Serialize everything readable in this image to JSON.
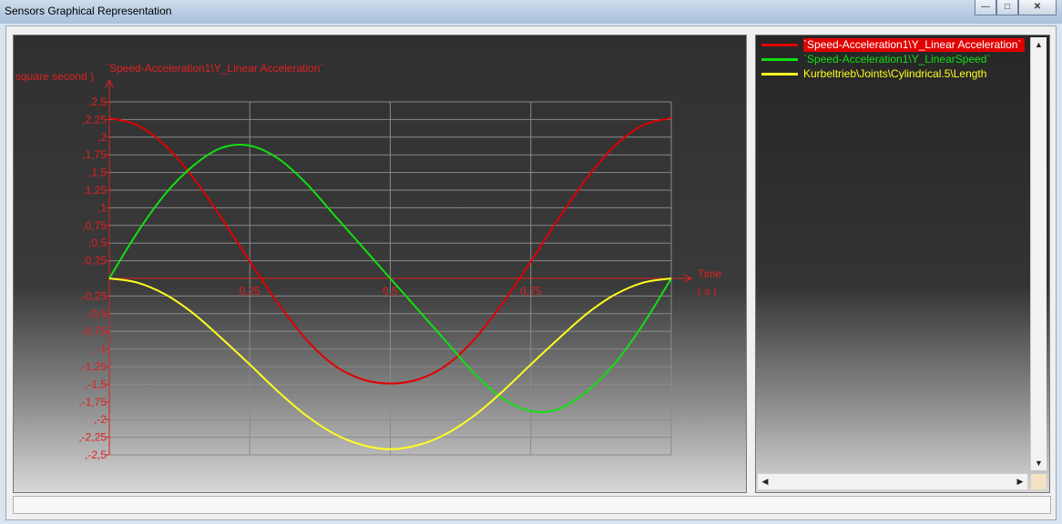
{
  "window": {
    "title": "Sensors Graphical Representation",
    "minimize_glyph": "—",
    "maximize_glyph": "□",
    "close_glyph": "✕"
  },
  "legend": {
    "items": [
      {
        "label": "`Speed-Acceleration1\\Y_Linear Acceleration`",
        "color": "#e00000",
        "selected": true
      },
      {
        "label": "`Speed-Acceleration1\\Y_LinearSpeed`",
        "color": "#10e010",
        "selected": false
      },
      {
        "label": "Kurbeltrieb\\Joints\\Cylindrical.5\\Length",
        "color": "#ffff20",
        "selected": false
      }
    ],
    "scroll_up_glyph": "▲",
    "scroll_down_glyph": "▼",
    "scroll_left_glyph": "◀",
    "scroll_right_glyph": "▶"
  },
  "status": {
    "text": ""
  },
  "chart_data": {
    "type": "line",
    "ylabel": "square second )",
    "ylabel_series": "`Speed-Acceleration1\\Y_Linear Acceleration`",
    "xlabel": "Time",
    "xunit": "( s )",
    "xlim": [
      0,
      1
    ],
    "ylim": [
      -2.5,
      2.5
    ],
    "x_ticks": [
      {
        "v": 0.25,
        "label": "0,25"
      },
      {
        "v": 0.5,
        "label": "0,5"
      },
      {
        "v": 0.75,
        "label": "0,75"
      }
    ],
    "y_ticks": [
      {
        "v": 2.5,
        "label": ",2,5"
      },
      {
        "v": 2.25,
        "label": ",2,25"
      },
      {
        "v": 2.0,
        "label": ",2"
      },
      {
        "v": 1.75,
        "label": ",1,75"
      },
      {
        "v": 1.5,
        "label": ",1,5"
      },
      {
        "v": 1.25,
        "label": ",1,25"
      },
      {
        "v": 1.0,
        "label": ",1"
      },
      {
        "v": 0.75,
        "label": ",0,75"
      },
      {
        "v": 0.5,
        "label": ",0,5"
      },
      {
        "v": 0.25,
        "label": ",0,25"
      },
      {
        "v": -0.25,
        "label": ",-0,25"
      },
      {
        "v": -0.5,
        "label": ",-0,5"
      },
      {
        "v": -0.75,
        "label": ",-0,75"
      },
      {
        "v": -1.0,
        "label": ",-1"
      },
      {
        "v": -1.25,
        "label": ",-1,25"
      },
      {
        "v": -1.5,
        "label": ",-1,5"
      },
      {
        "v": -1.75,
        "label": ",-1,75"
      },
      {
        "v": -2.0,
        "label": ",-2"
      },
      {
        "v": -2.25,
        "label": ",-2,25"
      },
      {
        "v": -2.5,
        "label": ",-2,5"
      }
    ],
    "grid": true,
    "series": [
      {
        "name": "`Speed-Acceleration1\\Y_Linear Acceleration`",
        "color": "#e00000",
        "x": [
          0,
          0.05,
          0.1,
          0.15,
          0.2,
          0.25,
          0.3,
          0.35,
          0.4,
          0.45,
          0.5,
          0.55,
          0.6,
          0.65,
          0.7,
          0.75,
          0.8,
          0.85,
          0.9,
          0.95,
          1.0
        ],
        "y": [
          2.27,
          2.17,
          1.88,
          1.42,
          0.85,
          0.24,
          -0.35,
          -0.86,
          -1.23,
          -1.43,
          -1.49,
          -1.43,
          -1.23,
          -0.86,
          -0.35,
          0.24,
          0.85,
          1.42,
          1.88,
          2.17,
          2.27
        ]
      },
      {
        "name": "`Speed-Acceleration1\\Y_LinearSpeed`",
        "color": "#10e010",
        "x": [
          0,
          0.05,
          0.1,
          0.15,
          0.2,
          0.25,
          0.3,
          0.35,
          0.4,
          0.45,
          0.5,
          0.55,
          0.6,
          0.65,
          0.7,
          0.75,
          0.8,
          0.85,
          0.9,
          0.95,
          1.0
        ],
        "y": [
          0,
          0.65,
          1.2,
          1.6,
          1.85,
          1.88,
          1.7,
          1.35,
          0.9,
          0.45,
          0,
          -0.45,
          -0.9,
          -1.35,
          -1.7,
          -1.88,
          -1.85,
          -1.6,
          -1.2,
          -0.65,
          0
        ]
      },
      {
        "name": "Kurbeltrieb\\Joints\\Cylindrical.5\\Length",
        "color": "#ffff20",
        "x": [
          0,
          0.05,
          0.1,
          0.15,
          0.2,
          0.25,
          0.3,
          0.35,
          0.4,
          0.45,
          0.5,
          0.55,
          0.6,
          0.65,
          0.7,
          0.75,
          0.8,
          0.85,
          0.9,
          0.95,
          1.0
        ],
        "y": [
          0,
          -0.06,
          -0.23,
          -0.5,
          -0.85,
          -1.22,
          -1.6,
          -1.94,
          -2.2,
          -2.36,
          -2.42,
          -2.36,
          -2.2,
          -1.94,
          -1.6,
          -1.22,
          -0.85,
          -0.5,
          -0.23,
          -0.06,
          0
        ]
      }
    ]
  }
}
